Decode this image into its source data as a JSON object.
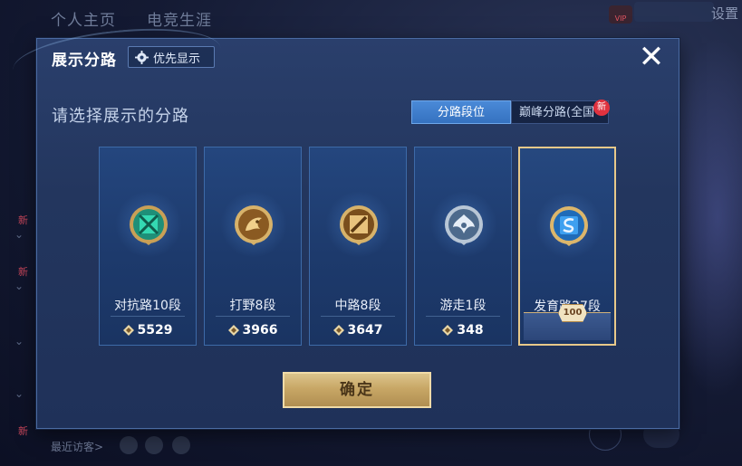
{
  "background": {
    "tabs": [
      "个人主页",
      "电竞生涯"
    ],
    "settings_label": "设置",
    "vip_label": "VIP",
    "new_marks": [
      "新",
      "新",
      "新"
    ],
    "recent_visitors_label": "最近访客>"
  },
  "dialog": {
    "title": "展示分路",
    "priority_button_label": "优先显示",
    "close_icon": "close-icon",
    "prompt": "请选择展示的分路",
    "tabs": [
      {
        "label": "分路段位",
        "active": true
      },
      {
        "label": "巅峰分路(全国",
        "active": false,
        "badge": "新"
      }
    ],
    "lanes": [
      {
        "name": "对抗路10段",
        "score": "5529",
        "icon": "clash-lane-emblem",
        "color": "#27c4a0",
        "selected": false
      },
      {
        "name": "打野8段",
        "score": "3966",
        "icon": "jungle-emblem",
        "color": "#b07a34",
        "selected": false
      },
      {
        "name": "中路8段",
        "score": "3647",
        "icon": "mid-lane-emblem",
        "color": "#b07a34",
        "selected": false
      },
      {
        "name": "游走1段",
        "score": "348",
        "icon": "roam-emblem",
        "color": "#8aa0b8",
        "selected": false
      },
      {
        "name": "发育路27段",
        "score": "",
        "icon": "farm-lane-emblem",
        "color": "#2f8ad8",
        "selected": true,
        "badge": "100"
      }
    ],
    "confirm_label": "确定"
  },
  "colors": {
    "accent_blue": "#3572c0",
    "gold": "#c8a766",
    "selected_border": "#e8c98a",
    "new_badge": "#e0323f"
  }
}
